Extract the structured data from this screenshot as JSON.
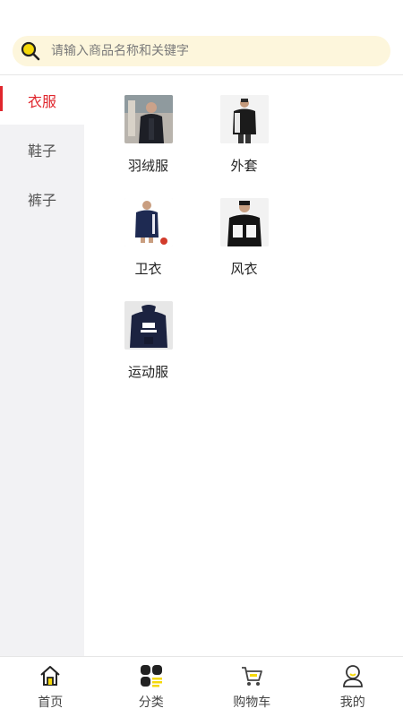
{
  "search": {
    "placeholder": "请输入商品名称和关键字",
    "icon": "search-icon"
  },
  "sidebar": {
    "items": [
      {
        "label": "衣服",
        "active": true
      },
      {
        "label": "鞋子",
        "active": false
      },
      {
        "label": "裤子",
        "active": false
      }
    ],
    "active_color": "#e0262d"
  },
  "grid": {
    "items": [
      {
        "label": "羽绒服",
        "image": "down-jacket-photo"
      },
      {
        "label": "外套",
        "image": "jacket-photo"
      },
      {
        "label": "卫衣",
        "image": "hoodie-photo"
      },
      {
        "label": "风衣",
        "image": "windbreaker-photo"
      },
      {
        "label": "运动服",
        "image": "sportswear-photo"
      }
    ]
  },
  "tabbar": {
    "items": [
      {
        "label": "首页",
        "icon": "home-icon"
      },
      {
        "label": "分类",
        "icon": "category-icon",
        "active": true
      },
      {
        "label": "购物车",
        "icon": "cart-icon"
      },
      {
        "label": "我的",
        "icon": "profile-icon"
      }
    ],
    "accent_color": "#f5d90a"
  }
}
